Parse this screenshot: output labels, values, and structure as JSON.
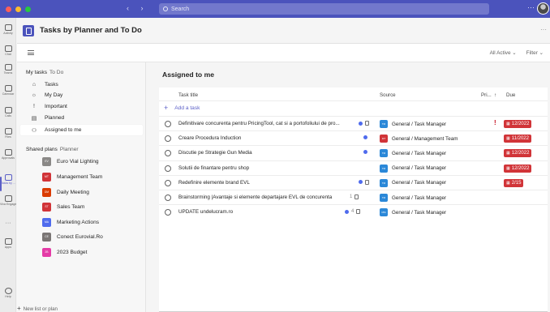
{
  "titlebar": {
    "nav": "‹   ›",
    "search_placeholder": "Search",
    "more": "···",
    "traffic_colors": [
      "#ff5f57",
      "#febc2e",
      "#28c840"
    ]
  },
  "rail": [
    {
      "label": "Activity",
      "icon": "bell-icon"
    },
    {
      "label": "Chat",
      "icon": "chat-icon"
    },
    {
      "label": "Teams",
      "icon": "teams-icon"
    },
    {
      "label": "Calendar",
      "icon": "calendar-icon"
    },
    {
      "label": "Calls",
      "icon": "phone-icon"
    },
    {
      "label": "Files",
      "icon": "file-icon"
    },
    {
      "label": "Approvals",
      "icon": "approvals-icon"
    },
    {
      "label": "Tasks by ...",
      "icon": "tasks-icon"
    },
    {
      "label": "Viva Engage",
      "icon": "viva-engage-icon"
    },
    {
      "label": "···",
      "icon": "more-apps-icon"
    },
    {
      "label": "Apps",
      "icon": "apps-icon"
    },
    {
      "label": "Help",
      "icon": "help-icon"
    }
  ],
  "app": {
    "title": "Tasks by Planner and To Do",
    "more": "···",
    "filter_active": "All Active ⌄",
    "filter": "Filter ⌄"
  },
  "side": {
    "my_tasks": "My tasks",
    "my_tasks_sub": "To Do",
    "items": [
      {
        "label": "Tasks",
        "icon": "home-icon",
        "glyph": "⌂"
      },
      {
        "label": "My Day",
        "icon": "sun-icon",
        "glyph": "☼"
      },
      {
        "label": "Important",
        "icon": "important-icon",
        "glyph": "!"
      },
      {
        "label": "Planned",
        "icon": "calendar-icon",
        "glyph": "▤"
      },
      {
        "label": "Assigned to me",
        "icon": "person-icon",
        "glyph": "⚇"
      }
    ],
    "shared_plans": "Shared plans",
    "shared_plans_sub": "Planner",
    "plans": [
      {
        "label": "Euro Vial Lighting",
        "initials": "EV",
        "color": "#8a8886"
      },
      {
        "label": "Management Team",
        "initials": "MT",
        "color": "#d13438"
      },
      {
        "label": "Daily Meeting",
        "initials": "DM",
        "color": "#da3b01"
      },
      {
        "label": "Sales Team",
        "initials": "ST",
        "color": "#d13438"
      },
      {
        "label": "Marketing Actions",
        "initials": "MA",
        "color": "#4f6bed"
      },
      {
        "label": "Conect Eurovial.Ro",
        "initials": "CE",
        "color": "#7a7574"
      },
      {
        "label": "2023 Budget",
        "initials": "2B",
        "color": "#e43ba6"
      }
    ],
    "new_list": "New list or plan"
  },
  "main": {
    "title": "Assigned to me",
    "columns": {
      "task": "Task title",
      "source": "Source",
      "priority": "Pri...",
      "sort": "↑",
      "due": "Due"
    },
    "add_task": "Add a task",
    "tasks": [
      {
        "title": "Definitivare concurenta pentru PricingTool, cat si a portofoliului de pro...",
        "indicator": "",
        "has_blue": true,
        "has_doc": true,
        "source": "General / Task Manager",
        "src_initials": "TM",
        "src_color": "#2b88d8",
        "priority": "!",
        "due": "12/2022"
      },
      {
        "title": "Creare Procedura Induction",
        "indicator": "",
        "has_blue": true,
        "has_doc": false,
        "source": "General / Management Team",
        "src_initials": "MT",
        "src_color": "#d13438",
        "priority": "",
        "due": "11/2022"
      },
      {
        "title": "Discutie pe Strategie Gun Media",
        "indicator": "",
        "has_blue": true,
        "has_doc": false,
        "source": "General / Task Manager",
        "src_initials": "TM",
        "src_color": "#2b88d8",
        "priority": "",
        "due": "12/2022"
      },
      {
        "title": "Solutii de finantare pentru shop",
        "indicator": "",
        "has_blue": false,
        "has_doc": false,
        "source": "General / Task Manager",
        "src_initials": "TM",
        "src_color": "#2b88d8",
        "priority": "",
        "due": "12/2022"
      },
      {
        "title": "Redefinire elemente brand EVL",
        "indicator": "",
        "has_blue": true,
        "has_doc": true,
        "source": "General / Task Manager",
        "src_initials": "TM",
        "src_color": "#2b88d8",
        "priority": "",
        "due": "2/15"
      },
      {
        "title": "Brainstorming |Avantaje si elemente departajare EVL de concurenta",
        "indicator": "1",
        "has_blue": false,
        "has_doc": true,
        "source": "General / Task Manager",
        "src_initials": "TM",
        "src_color": "#2b88d8",
        "priority": "",
        "due": ""
      },
      {
        "title": "UPDATE undelucram.ro",
        "indicator": "4",
        "has_blue": true,
        "has_doc": true,
        "source": "General / Task Manager",
        "src_initials": "MM",
        "src_color": "#2b88d8",
        "priority": "",
        "due": ""
      }
    ]
  }
}
